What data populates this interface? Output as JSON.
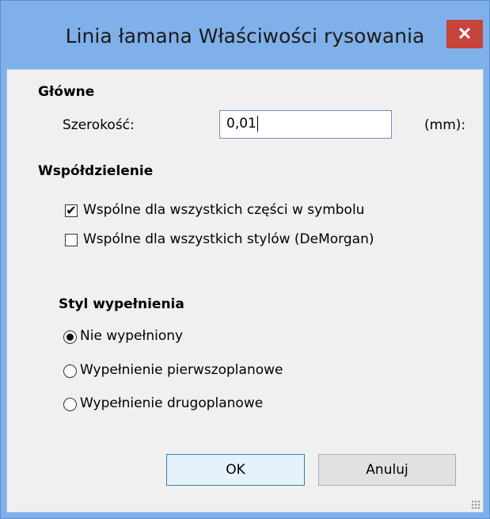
{
  "window": {
    "title": "Linia łamana Właściwości rysowania",
    "close_glyph": "✕"
  },
  "general": {
    "heading": "Główne",
    "width_label": "Szerokość:",
    "width_value": "0,01",
    "unit_label": "(mm):"
  },
  "sharing": {
    "heading": "Współdzielenie",
    "options": [
      {
        "label": "Wspólne dla wszystkich części w symbolu",
        "checked": true
      },
      {
        "label": "Wspólne dla wszystkich stylów (DeMorgan)",
        "checked": false
      }
    ],
    "check_glyph": "✔"
  },
  "fill_style": {
    "heading": "Styl wypełnienia",
    "options": [
      {
        "label": "Nie wypełniony",
        "selected": true
      },
      {
        "label": "Wypełnienie pierwszoplanowe",
        "selected": false
      },
      {
        "label": "Wypełnienie drugoplanowe",
        "selected": false
      }
    ]
  },
  "buttons": {
    "ok": "OK",
    "cancel": "Anuluj"
  },
  "colors": {
    "frame": "#7fb0ea",
    "close_button": "#c7443a",
    "client_bg": "#f0f0f0"
  }
}
